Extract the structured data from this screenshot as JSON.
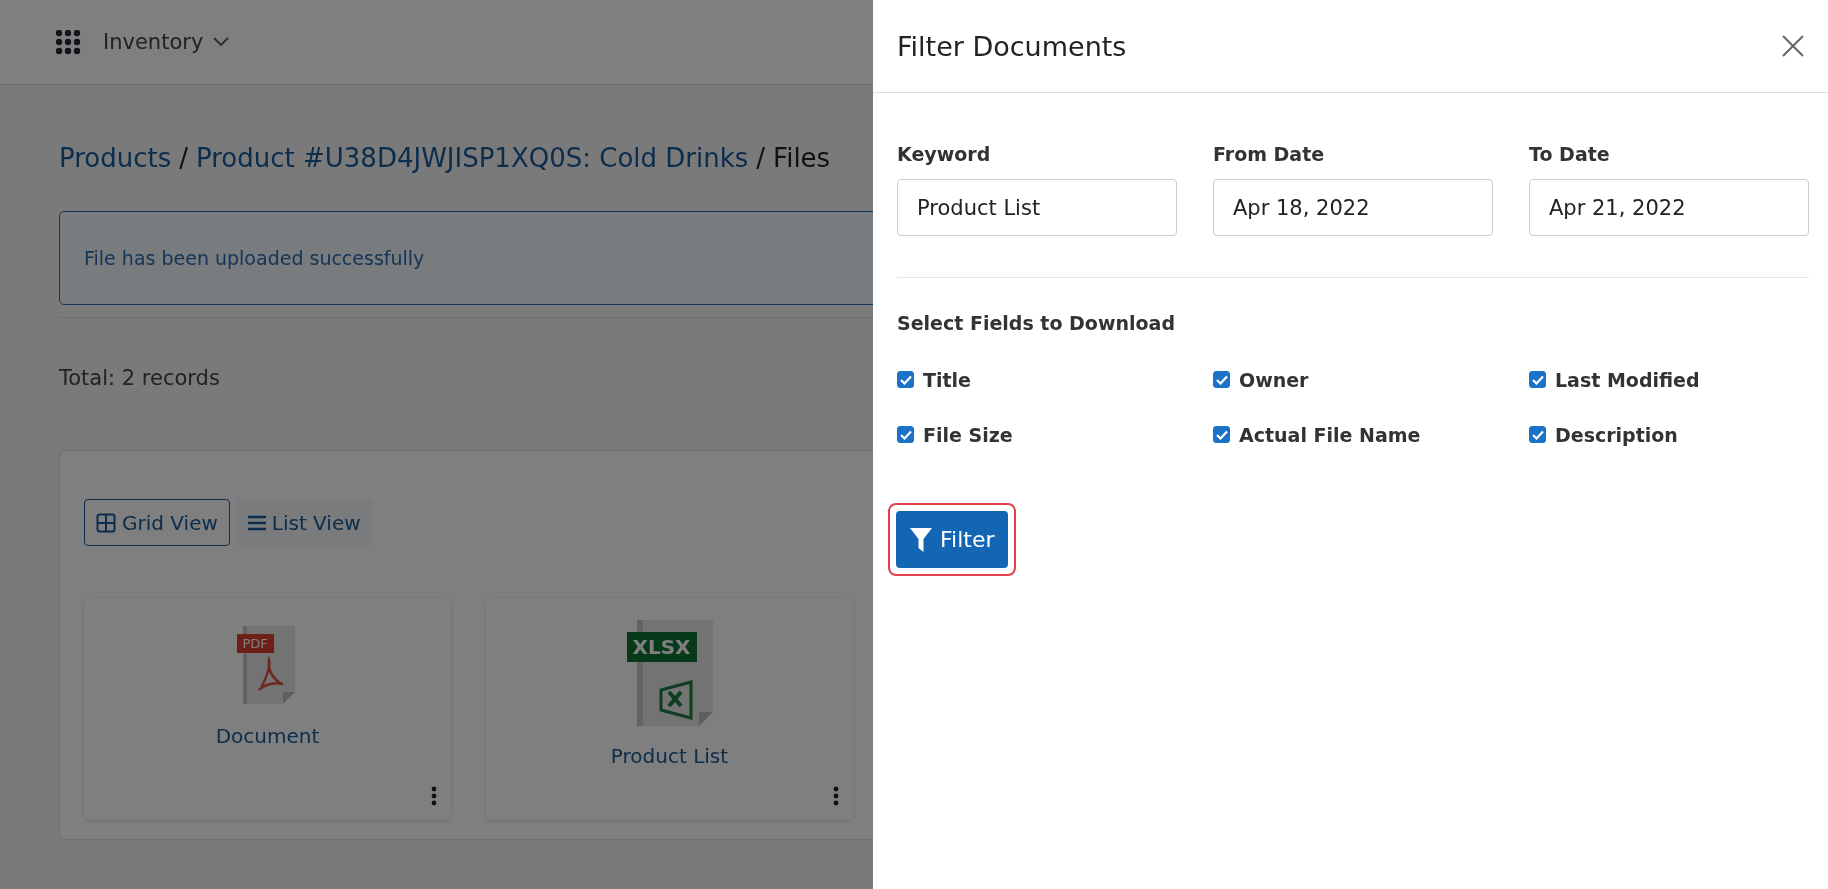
{
  "topbar": {
    "app": "Inventory"
  },
  "breadcrumb": [
    {
      "text": "Products",
      "kind": "link"
    },
    {
      "text": "/",
      "kind": "separator"
    },
    {
      "text": "Product #U38D4JWJISP1XQ0S: Cold Drinks",
      "kind": "link"
    },
    {
      "text": "/",
      "kind": "separator"
    },
    {
      "text": "Files",
      "kind": "current"
    }
  ],
  "alert": "File has been uploaded successfully",
  "total": "Total: 2 records",
  "views": [
    {
      "label": "Grid View",
      "kind": "grid",
      "selected": true
    },
    {
      "label": "List View",
      "kind": "list",
      "selected": false
    }
  ],
  "files": [
    {
      "name": "Document",
      "kind": "pdf",
      "badge": "PDF"
    },
    {
      "name": "Product List",
      "kind": "xlsx",
      "badge": "XLSX"
    }
  ],
  "drawer": {
    "title": "Filter Documents",
    "fields": [
      {
        "label": "Keyword",
        "value": "Product List"
      },
      {
        "label": "From Date",
        "value": "Apr 18, 2022"
      },
      {
        "label": "To Date",
        "value": "Apr 21, 2022"
      }
    ],
    "section": "Select Fields to Download",
    "checkboxes": [
      {
        "label": "Title",
        "checked": true
      },
      {
        "label": "Owner",
        "checked": true
      },
      {
        "label": "Last Modified",
        "checked": true
      },
      {
        "label": "File Size",
        "checked": true
      },
      {
        "label": "Actual File Name",
        "checked": true
      },
      {
        "label": "Description",
        "checked": true
      }
    ],
    "button": "Filter"
  }
}
